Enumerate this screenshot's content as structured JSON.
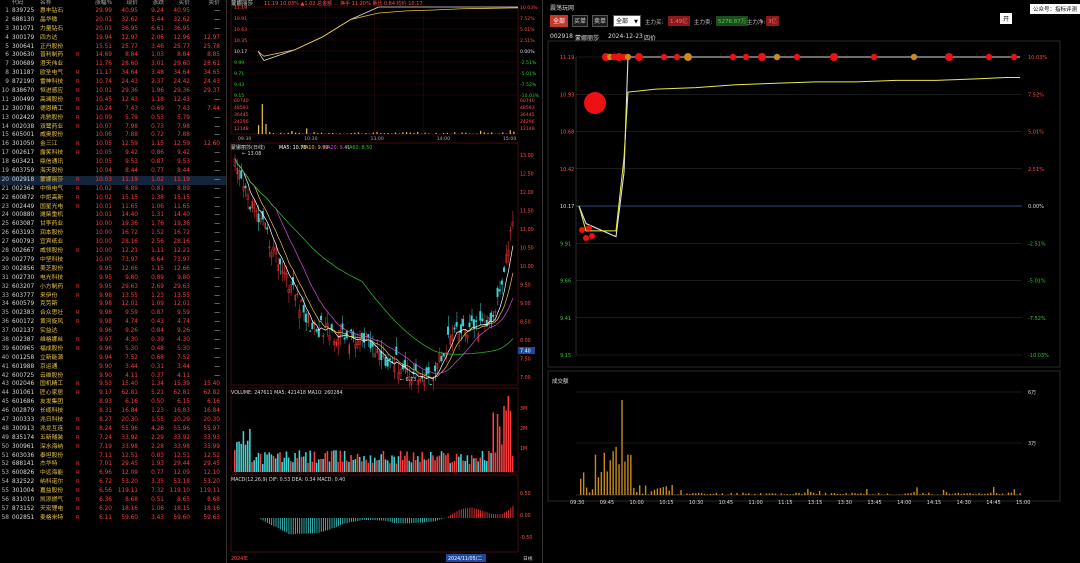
{
  "stock_list": {
    "headers": [
      "",
      "代码",
      "名称",
      "",
      "涨幅%",
      "现价",
      "涨跌",
      "买价",
      "卖价"
    ],
    "rows": [
      [
        "1",
        "839725",
        "惠丰钻石",
        "",
        "29.99",
        "40.95",
        "9.24",
        "40.95",
        "—"
      ],
      [
        "2",
        "688130",
        "晶华微",
        "",
        "20.01",
        "32.62",
        "5.44",
        "32.62",
        "—"
      ],
      [
        "3",
        "301071",
        "力量钻石",
        "",
        "20.01",
        "36.95",
        "6.61",
        "36.95",
        "—"
      ],
      [
        "4",
        "300179",
        "四方达",
        "",
        "19.94",
        "12.97",
        "2.06",
        "12.96",
        "12.97"
      ],
      [
        "5",
        "300641",
        "正丹股份",
        "",
        "15.51",
        "25.77",
        "3.46",
        "25.77",
        "25.78"
      ],
      [
        "6",
        "300630",
        "普利制药",
        "R",
        "14.69",
        "8.84",
        "1.03",
        "8.84",
        "8.85"
      ],
      [
        "7",
        "300689",
        "澄天伟业",
        "",
        "11.76",
        "28.60",
        "3.01",
        "29.60",
        "28.61"
      ],
      [
        "8",
        "301187",
        "欧圣电气",
        "R",
        "11.17",
        "34.64",
        "3.48",
        "34.64",
        "34.65"
      ],
      [
        "9",
        "872190",
        "雷神科技",
        "R",
        "10.74",
        "24.43",
        "2.37",
        "24.42",
        "24.43"
      ],
      [
        "10",
        "838670",
        "恒进感应",
        "R",
        "10.01",
        "29.36",
        "1.96",
        "29.36",
        "29.37"
      ],
      [
        "11",
        "300499",
        "高澜股份",
        "R",
        "10.45",
        "12.43",
        "1.18",
        "12.43",
        "—"
      ],
      [
        "12",
        "300780",
        "德恩精工",
        "R",
        "10.24",
        "7.43",
        "0.69",
        "7.43",
        "7.44"
      ],
      [
        "13",
        "002429",
        "兆驰股份",
        "R",
        "10.09",
        "5.79",
        "0.53",
        "5.79",
        "—"
      ],
      [
        "14",
        "002038",
        "双鹭药业",
        "R",
        "10.07",
        "7.98",
        "0.73",
        "7.98",
        "—"
      ],
      [
        "15",
        "605001",
        "威奥股份",
        "",
        "10.06",
        "7.88",
        "0.72",
        "7.88",
        "—"
      ],
      [
        "16",
        "301050",
        "金三江",
        "R",
        "10.05",
        "12.59",
        "1.15",
        "12.59",
        "12.60"
      ],
      [
        "17",
        "002617",
        "露笑科技",
        "R",
        "10.05",
        "9.42",
        "0.86",
        "9.42",
        "—"
      ],
      [
        "18",
        "603421",
        "鼎信通讯",
        "",
        "10.05",
        "9.53",
        "0.87",
        "9.53",
        "—"
      ],
      [
        "19",
        "603759",
        "海天股份",
        "",
        "10.04",
        "8.44",
        "0.77",
        "8.44",
        "—"
      ],
      [
        "20",
        "002918",
        "蒙娜丽莎",
        "R",
        "10.03",
        "11.19",
        "1.02",
        "11.19",
        "—"
      ],
      [
        "21",
        "002364",
        "中恒电气",
        "R",
        "10.02",
        "8.89",
        "0.81",
        "8.89",
        "—"
      ],
      [
        "22",
        "600872",
        "中炬高新",
        "R",
        "10.02",
        "15.15",
        "1.38",
        "15.15",
        "—"
      ],
      [
        "23",
        "002449",
        "国星光电",
        "R",
        "10.01",
        "11.65",
        "1.06",
        "11.65",
        "—"
      ],
      [
        "24",
        "000880",
        "潍柴重机",
        "",
        "10.01",
        "14.40",
        "1.31",
        "14.40",
        "—"
      ],
      [
        "25",
        "603087",
        "甘李药业",
        "",
        "10.00",
        "19.36",
        "1.76",
        "19.36",
        "—"
      ],
      [
        "26",
        "603193",
        "润本股份",
        "",
        "10.00",
        "16.72",
        "1.52",
        "16.72",
        "—"
      ],
      [
        "27",
        "600793",
        "宜宾纸业",
        "",
        "10.00",
        "28.16",
        "2.56",
        "28.16",
        "—"
      ],
      [
        "28",
        "002667",
        "威领股份",
        "R",
        "10.00",
        "12.21",
        "1.11",
        "12.21",
        "—"
      ],
      [
        "29",
        "002779",
        "中坚科技",
        "",
        "10.00",
        "73.97",
        "6.64",
        "73.97",
        "—"
      ],
      [
        "30",
        "002856",
        "美芝股份",
        "",
        "9.95",
        "12.66",
        "1.15",
        "12.66",
        "—"
      ],
      [
        "31",
        "002730",
        "电光科技",
        "",
        "9.95",
        "9.80",
        "0.89",
        "9.80",
        "—"
      ],
      [
        "32",
        "603207",
        "小方制药",
        "R",
        "9.95",
        "29.63",
        "2.69",
        "29.63",
        "—"
      ],
      [
        "33",
        "603777",
        "来伊份",
        "R",
        "9.98",
        "13.55",
        "1.23",
        "13.55",
        "—"
      ],
      [
        "34",
        "600579",
        "克劳斯",
        "",
        "9.98",
        "12.01",
        "1.09",
        "12.01",
        "—"
      ],
      [
        "35",
        "002383",
        "合众思壮",
        "R",
        "9.98",
        "9.59",
        "0.87",
        "9.59",
        "—"
      ],
      [
        "36",
        "600172",
        "黄河旋风",
        "R",
        "9.98",
        "4.74",
        "0.43",
        "4.74",
        "—"
      ],
      [
        "37",
        "002137",
        "实益达",
        "",
        "9.96",
        "9.26",
        "0.84",
        "9.26",
        "—"
      ],
      [
        "38",
        "002387",
        "维格娜丝",
        "R",
        "9.97",
        "4.30",
        "0.39",
        "4.30",
        "—"
      ],
      [
        "39",
        "600965",
        "福成股份",
        "R",
        "9.96",
        "5.30",
        "0.48",
        "5.30",
        "—"
      ],
      [
        "40",
        "001258",
        "立新能源",
        "",
        "9.94",
        "7.52",
        "0.68",
        "7.52",
        "—"
      ],
      [
        "41",
        "601988",
        "京运通",
        "",
        "9.90",
        "3.44",
        "0.31",
        "3.44",
        "—"
      ],
      [
        "42",
        "600725",
        "云维股份",
        "",
        "9.90",
        "4.11",
        "0.37",
        "4.11",
        "—"
      ],
      [
        "43",
        "002046",
        "国机精工",
        "R",
        "9.53",
        "15.40",
        "1.34",
        "15.39",
        "15.40"
      ],
      [
        "44",
        "301061",
        "匠心家居",
        "R",
        "9.17",
        "62.81",
        "5.21",
        "62.81",
        "62.82"
      ],
      [
        "45",
        "601686",
        "友发集团",
        "",
        "8.93",
        "6.16",
        "0.50",
        "6.15",
        "6.16"
      ],
      [
        "46",
        "002879",
        "长缆科技",
        "",
        "8.31",
        "16.84",
        "1.23",
        "16.83",
        "16.84"
      ],
      [
        "47",
        "300333",
        "兆日科技",
        "R",
        "8.27",
        "20.30",
        "1.55",
        "20.29",
        "20.30"
      ],
      [
        "48",
        "300913",
        "兆龙互连",
        "R",
        "8.24",
        "55.96",
        "4.26",
        "55.96",
        "55.97"
      ],
      [
        "49",
        "835174",
        "五新隧装",
        "R",
        "7.24",
        "33.92",
        "2.29",
        "33.92",
        "33.93"
      ],
      [
        "50",
        "300961",
        "深水海纳",
        "R",
        "7.19",
        "33.98",
        "2.28",
        "33.98",
        "33.99"
      ],
      [
        "51",
        "603036",
        "泰坦股份",
        "",
        "7.11",
        "12.51",
        "0.83",
        "12.51",
        "12.52"
      ],
      [
        "52",
        "688141",
        "杰华特",
        "R",
        "7.01",
        "29.45",
        "1.93",
        "29.44",
        "29.45"
      ],
      [
        "53",
        "600826",
        "中远海能",
        "R",
        "6.96",
        "12.09",
        "0.77",
        "12.09",
        "12.10"
      ],
      [
        "54",
        "832522",
        "纳科诺尔",
        "R",
        "6.72",
        "53.20",
        "3.35",
        "53.18",
        "53.20"
      ],
      [
        "55",
        "301004",
        "嘉益股份",
        "R",
        "6.56",
        "119.11",
        "7.32",
        "119.10",
        "119.11"
      ],
      [
        "56",
        "831010",
        "凯添燃气",
        "R",
        "6.36",
        "8.68",
        "0.51",
        "8.65",
        "8.68"
      ],
      [
        "57",
        "873152",
        "天宏锂电",
        "R",
        "6.20",
        "18.16",
        "1.06",
        "18.15",
        "18.16"
      ],
      [
        "58",
        "002851",
        "麦格米特",
        "R",
        "6.11",
        "59.60",
        "3.43",
        "59.60",
        "59.63"
      ]
    ]
  },
  "mini_intraday": {
    "title": "蒙娜丽莎",
    "stats": "11.19 10.03% ▲1.02 总金额 ... 换手 11.20% 量比 0.84 均价 10.17",
    "price_ticks": [
      "11.19",
      "10.91",
      "10.63",
      "10.35",
      "10.17",
      "9.99",
      "9.71",
      "9.43",
      "9.15"
    ],
    "pct_ticks": [
      "10.03%",
      "7.52%",
      "5.01%",
      "2.51%",
      "0.00%",
      "-2.51%",
      "-5.01%",
      "-7.52%",
      "-10.03%"
    ],
    "vol_ticks": [
      "60740",
      "48593",
      "36445",
      "24296",
      "12148"
    ],
    "time_ticks": [
      "09:30",
      "10:30",
      "13:00",
      "14:00",
      "15:00"
    ]
  },
  "kline": {
    "title": "蒙娜丽莎(日线)",
    "ma_legend": [
      "MA5: 10.73",
      "MA10: 9.99",
      "MA20: 9.41",
      "MA60: 8.50"
    ],
    "ma_colors": [
      "#ffffff",
      "#e8c546",
      "#d34fd3",
      "#2ec72e"
    ],
    "high_label": "13.08",
    "low_label": "6.73",
    "price_ticks": [
      "13.00",
      "12.50",
      "12.00",
      "11.50",
      "11.00",
      "10.50",
      "10.00",
      "9.50",
      "9.00",
      "8.50",
      "8.00",
      "7.50",
      "7.00"
    ],
    "current_tag": "7.40",
    "volume_legend": "VOLUME: 247611  MA5: 421418  MA10: 260284",
    "vol_ticks": [
      "3M",
      "2M",
      "1M"
    ],
    "macd_legend": "MACD(12,26,9)  DIF: 0.53  DEA: 0.34  MACD: 0.40",
    "macd_ticks": [
      "0.50",
      "0.00",
      "-0.50"
    ],
    "date_left": "2024年",
    "date_cursor": "2024/11/05/二",
    "period_btn": "日线"
  },
  "right_panel": {
    "title": "震荡玩网",
    "btn_all": "全部",
    "btn_buy": "买单",
    "btn_sell": "卖单",
    "select_value": "全部",
    "lbl_in": "主力买:",
    "val_in": "1.49亿",
    "lbl_out": "主力卖:",
    "val_out": "5276.87万",
    "lbl_net": "主力净:",
    "val_net": "3亿",
    "code": "002918",
    "name": "蒙娜丽莎",
    "date": "2024-12-23",
    "mode": "四价",
    "left_ticks": [
      "11.19",
      "10.93",
      "10.68",
      "10.42",
      "10.17",
      "9.91",
      "9.66",
      "9.41",
      "9.15"
    ],
    "right_ticks": [
      "10.03%",
      "7.52%",
      "5.01%",
      "2.51%",
      "0.00%",
      "-2.51%",
      "-5.01%",
      "-7.52%",
      "-10.03%"
    ],
    "volume_title": "成交额",
    "vol_ticks": [
      "6万",
      "3万"
    ],
    "time_ticks": [
      "09:30",
      "09:45",
      "10:00",
      "10:15",
      "10:30",
      "10:45",
      "11:00",
      "11:15",
      "13:15",
      "13:30",
      "13:45",
      "14:00",
      "14:15",
      "14:30",
      "14:45",
      "15:00"
    ]
  },
  "top_right": {
    "link": "公众号：指标评测",
    "toggle": "开"
  },
  "chart_data": [
    {
      "type": "line",
      "title": "蒙娜丽莎",
      "series": [
        {
          "name": "价格",
          "values": [
            10.17,
            10.05,
            9.95,
            10.2,
            10.5,
            10.9,
            11.19,
            11.19,
            11.19,
            11.19,
            11.19,
            11.19
          ]
        },
        {
          "name": "均价",
          "values": [
            10.17,
            10.1,
            10.05,
            10.2,
            10.5,
            10.9,
            11.05,
            11.1,
            11.12,
            11.15,
            11.16,
            11.17
          ]
        }
      ],
      "ylim": [
        9.15,
        11.19
      ]
    },
    {
      "type": "line",
      "title": "蒙娜丽莎(日线)",
      "ylim": [
        6.73,
        13.08
      ]
    },
    {
      "type": "bar",
      "title": "成交额",
      "ylim": [
        0,
        6
      ]
    },
    {
      "type": "line",
      "title": "震荡玩网",
      "series": [
        {
          "name": "价格",
          "values": [
            10.17,
            10.05,
            9.96,
            10.4,
            11.19,
            11.19,
            11.19,
            11.19,
            11.19,
            11.19,
            11.19,
            11.19,
            11.19,
            11.19,
            11.19,
            11.19
          ]
        },
        {
          "name": "均价",
          "values": [
            10.17,
            10.0,
            10.0,
            10.5,
            10.95,
            10.97,
            10.98,
            11.0,
            11.01,
            11.02,
            11.02,
            11.03,
            11.03,
            11.04,
            11.05,
            11.05
          ]
        }
      ],
      "ylim": [
        9.15,
        11.19
      ]
    }
  ]
}
